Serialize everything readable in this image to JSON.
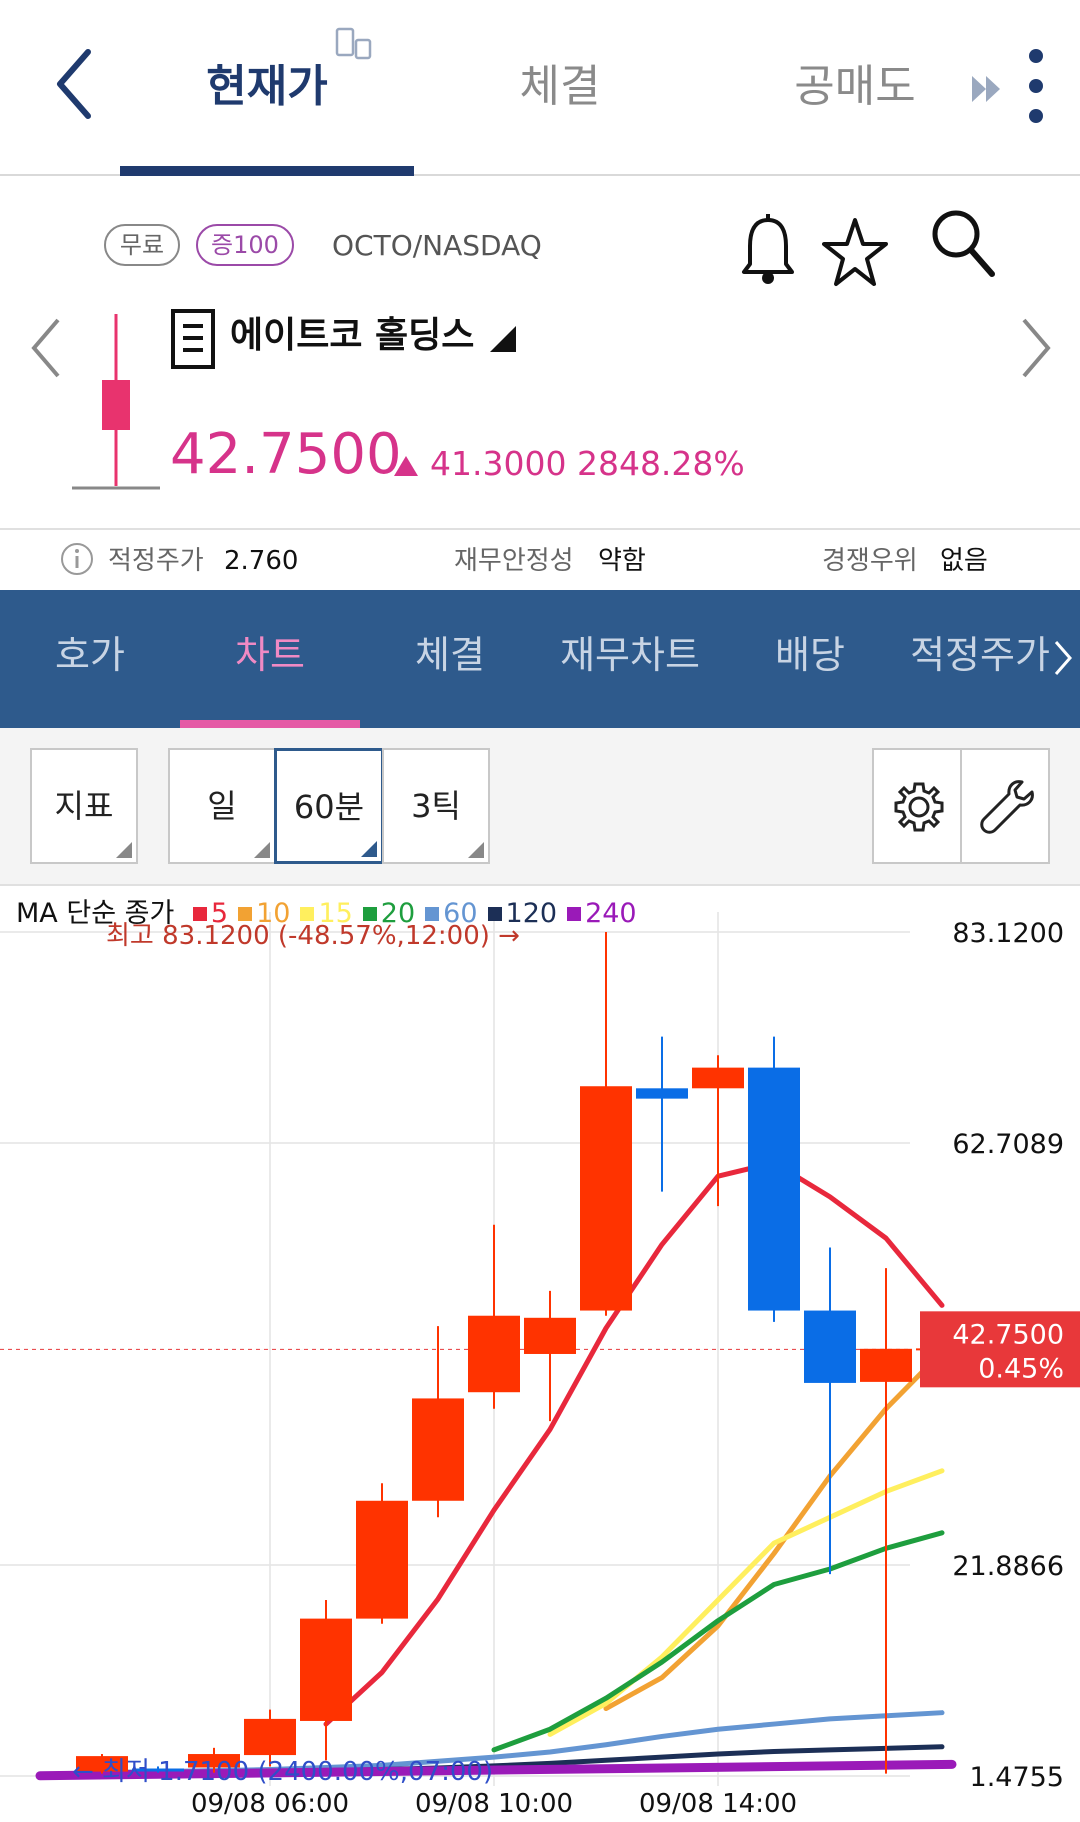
{
  "header": {
    "tabs": [
      {
        "label": "현재가",
        "active": true
      },
      {
        "label": "체결",
        "active": false
      },
      {
        "label": "공매도",
        "active": false
      }
    ]
  },
  "stock": {
    "badge_free": "무료",
    "badge_margin": "증100",
    "ticker": "OCTO/NASDAQ",
    "name": "에이트코 홀딩스",
    "price": "42.7500",
    "change": "41.3000 2848.28%",
    "change_direction": "up"
  },
  "metrics": [
    {
      "label": "적정주가",
      "value": "2.760"
    },
    {
      "label": "재무안정성",
      "value": "약함"
    },
    {
      "label": "경쟁우위",
      "value": "없음"
    }
  ],
  "subtabs": [
    "호가",
    "차트",
    "체결",
    "재무차트",
    "배당",
    "적정주가"
  ],
  "active_subtab": "차트",
  "toolbar": {
    "indicator_label": "지표",
    "periods": [
      "일",
      "60분",
      "3틱"
    ],
    "selected_period": "60분"
  },
  "colors": {
    "navy": "#1f3a6e",
    "subtab_bg": "#2e5a8c",
    "price_up": "#d6338a",
    "candle_up": "#ff3300",
    "candle_down": "#0a6de6",
    "current_price_box": "#e8383a"
  },
  "chart_data": {
    "type": "candlestick",
    "legend_title": "MA 단순 종가",
    "ma_legend": [
      {
        "label": "5",
        "color": "#e8283c"
      },
      {
        "label": "10",
        "color": "#f2a233"
      },
      {
        "label": "15",
        "color": "#ffef5e"
      },
      {
        "label": "20",
        "color": "#1e9e3e"
      },
      {
        "label": "60",
        "color": "#6495d2"
      },
      {
        "label": "120",
        "color": "#1c2f56"
      },
      {
        "label": "240",
        "color": "#9a1ab8"
      }
    ],
    "y_ticks": [
      "83.1200",
      "62.7089",
      "21.8866",
      "1.4755"
    ],
    "y_tick_values": [
      83.12,
      62.7089,
      21.8866,
      1.4755
    ],
    "ylim": [
      1.4755,
      83.12
    ],
    "x_tick_labels": [
      "09/08 06:00",
      "09/08 10:00",
      "09/08 14:00"
    ],
    "x_tick_index": [
      3,
      7,
      11
    ],
    "high_annotation": "최고 83.1200 (-48.57%,12:00) →",
    "low_annotation": "← 최저 1.7100 (2400.00%,07:00)",
    "current_price_label": "42.7500",
    "current_change_label": "0.45%",
    "current_price": 42.75,
    "candles": [
      {
        "open": 1.9,
        "high": 3.6,
        "low": 1.71,
        "close": 3.4
      },
      {
        "open": 2.2,
        "high": 2.4,
        "low": 1.8,
        "close": 2.1
      },
      {
        "open": 2.3,
        "high": 4.2,
        "low": 1.8,
        "close": 3.6
      },
      {
        "open": 3.5,
        "high": 7.9,
        "low": 2.4,
        "close": 7.0
      },
      {
        "open": 6.8,
        "high": 18.5,
        "low": 3.0,
        "close": 16.7
      },
      {
        "open": 16.7,
        "high": 29.8,
        "low": 16.2,
        "close": 28.1
      },
      {
        "open": 28.1,
        "high": 45.0,
        "low": 26.5,
        "close": 38.0
      },
      {
        "open": 38.6,
        "high": 54.8,
        "low": 37.0,
        "close": 46.0
      },
      {
        "open": 42.3,
        "high": 48.4,
        "low": 35.8,
        "close": 45.8
      },
      {
        "open": 46.5,
        "high": 83.12,
        "low": 46.0,
        "close": 68.2
      },
      {
        "open": 68.0,
        "high": 73.0,
        "low": 58.0,
        "close": 67.0
      },
      {
        "open": 68.0,
        "high": 71.2,
        "low": 56.6,
        "close": 70.0
      },
      {
        "open": 70.0,
        "high": 73.0,
        "low": 45.4,
        "close": 46.5
      },
      {
        "open": 46.5,
        "high": 52.6,
        "low": 21.0,
        "close": 39.5
      },
      {
        "open": 39.6,
        "high": 50.6,
        "low": 1.71,
        "close": 42.8
      },
      {
        "open": 42.75,
        "high": 44.3,
        "low": 40.8,
        "close": 42.75
      }
    ],
    "moving_averages": {
      "5": [
        null,
        null,
        null,
        null,
        6.5,
        11.5,
        18.6,
        27.2,
        35.0,
        44.8,
        52.9,
        59.5,
        60.8,
        57.5,
        53.5,
        47.0
      ],
      "10": [
        null,
        null,
        null,
        null,
        null,
        null,
        null,
        null,
        null,
        8.0,
        11.0,
        16.0,
        23.0,
        30.5,
        37.0,
        42.5,
        45.0
      ],
      "15": [
        null,
        null,
        null,
        null,
        null,
        null,
        null,
        null,
        5.5,
        8.5,
        13.0,
        18.5,
        24.0,
        26.5,
        29.0,
        31.0
      ],
      "20": [
        null,
        null,
        null,
        null,
        null,
        null,
        null,
        4.0,
        6.0,
        9.0,
        12.5,
        16.5,
        20.0,
        21.5,
        23.5,
        25.0
      ],
      "60": [
        1.8,
        1.9,
        2.0,
        2.1,
        2.3,
        2.5,
        2.9,
        3.3,
        3.8,
        4.5,
        5.3,
        6.0,
        6.5,
        7.0,
        7.3,
        7.6
      ],
      "120": [
        1.75,
        1.8,
        1.85,
        1.9,
        2.0,
        2.1,
        2.25,
        2.45,
        2.7,
        3.0,
        3.3,
        3.6,
        3.85,
        4.0,
        4.15,
        4.3
      ]
    }
  }
}
